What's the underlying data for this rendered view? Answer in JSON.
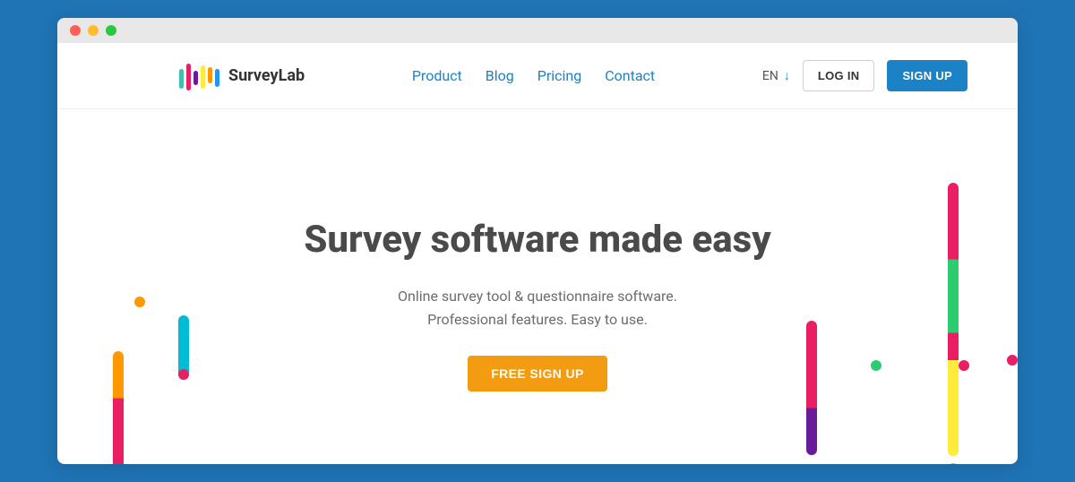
{
  "brand": {
    "name": "SurveyLab"
  },
  "nav": {
    "product": "Product",
    "blog": "Blog",
    "pricing": "Pricing",
    "contact": "Contact"
  },
  "lang": {
    "code": "EN"
  },
  "auth": {
    "login": "LOG IN",
    "signup": "SIGN UP"
  },
  "hero": {
    "headline": "Survey software made easy",
    "sub1": "Online survey tool & questionnaire software.",
    "sub2": "Professional features. Easy to use.",
    "cta": "FREE SIGN UP"
  },
  "colors": {
    "brand_blue": "#1b82c5",
    "accent_orange": "#f39c12",
    "text_dark": "#4a4a4a"
  }
}
